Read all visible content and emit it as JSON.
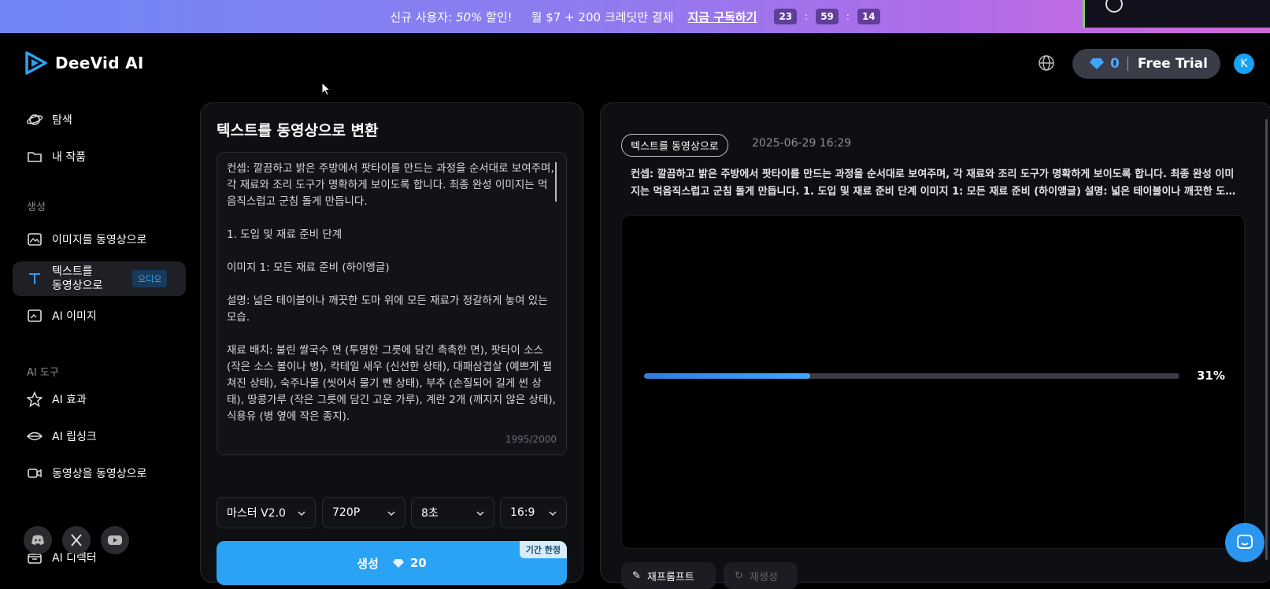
{
  "promo": {
    "text_prefix": "신규 사용자: ",
    "text_pct": "50%",
    "text_suffix": " 할인!",
    "offer": "월 $7 + 200 크레딧만 결제",
    "cta": "지금 구독하기",
    "countdown": {
      "hours": "23",
      "minutes": "59",
      "seconds": "14"
    },
    "sep": ":"
  },
  "header": {
    "logo": "DeeVid AI",
    "credits": "0",
    "plan": "Free Trial",
    "avatar": "K"
  },
  "sidebar": {
    "explore": "탐색",
    "my_works": "내 작품",
    "section_create": "생성",
    "image_to_video": "이미지를 동영상으로",
    "text_to_video_line1": "텍스트를",
    "text_to_video_line2": "동영상으로",
    "audio_badge": "오디오",
    "ai_image": "AI 이미지",
    "section_tools": "AI 도구",
    "ai_effects": "AI 효과",
    "ai_lipsync": "AI 립싱크",
    "video_to_video": "동영상을 동영상으로",
    "ai_director": "AI 디렉터"
  },
  "left_panel": {
    "title": "텍스트를 동영상으로 변환",
    "prompt": "컨셉: 깔끔하고 밝은 주방에서 팟타이를 만드는 과정을 순서대로 보여주며, 각 재료와 조리 도구가 명확하게 보이도록 합니다. 최종 완성 이미지는 먹음직스럽고 군침 돌게 만듭니다.\n\n1. 도입 및 재료 준비 단계\n\n이미지 1: 모든 재료 준비 (하이앵글)\n\n설명: 넓은 테이블이나 깨끗한 도마 위에 모든 재료가 정갈하게 놓여 있는 모습.\n\n재료 배치: 불린 쌀국수 면 (투명한 그릇에 담긴 촉촉한 면), 팟타이 소스 (작은 소스 볼이나 병), 칵테일 새우 (신선한 상태), 대패삼겹살 (예쁘게 펼쳐진 상태), 숙주나물 (씻어서 물기 뺀 상태), 부추 (손질되어 길게 썬 상태), 땅콩가루 (작은 그릇에 담긴 고운 가루), 계란 2개 (깨지지 않은 상태), 식용유 (병 옆에 작은 종지).",
    "counter": "1995/2000",
    "model": "마스터 V2.0",
    "resolution": "720P",
    "duration": "8초",
    "ratio": "16:9",
    "generate": "생성",
    "generate_cost": "20",
    "limited": "기간 한정"
  },
  "right_panel": {
    "tag": "텍스트를 동영상으로",
    "date": "2025-06-29 16:29",
    "description": "컨셉: 깔끔하고 밝은 주방에서 팟타이를 만드는 과정을 순서대로 보여주며, 각 재료와 조리 도구가 명확하게 보이도록 합니다. 최종 완성 이미지는 먹음직스럽고 군침 돌게 만듭니다. 1. 도입 및 재료 준비 단계 이미지 1: 모든 재료 준비 (하이앵글) 설명: 넓은 테이블이나 깨끗한 도마 위에 모든 재료가 정갈하게 놓여 있는 모습.",
    "progress_pct": "31%",
    "progress_value": 0.31,
    "reprompt": "재프롬프트",
    "regenerate": "재생성"
  },
  "colors": {
    "accent": "#2aa3f5",
    "credit_blue": "#4fa7ff",
    "panel_bg": "#0e0f12"
  }
}
